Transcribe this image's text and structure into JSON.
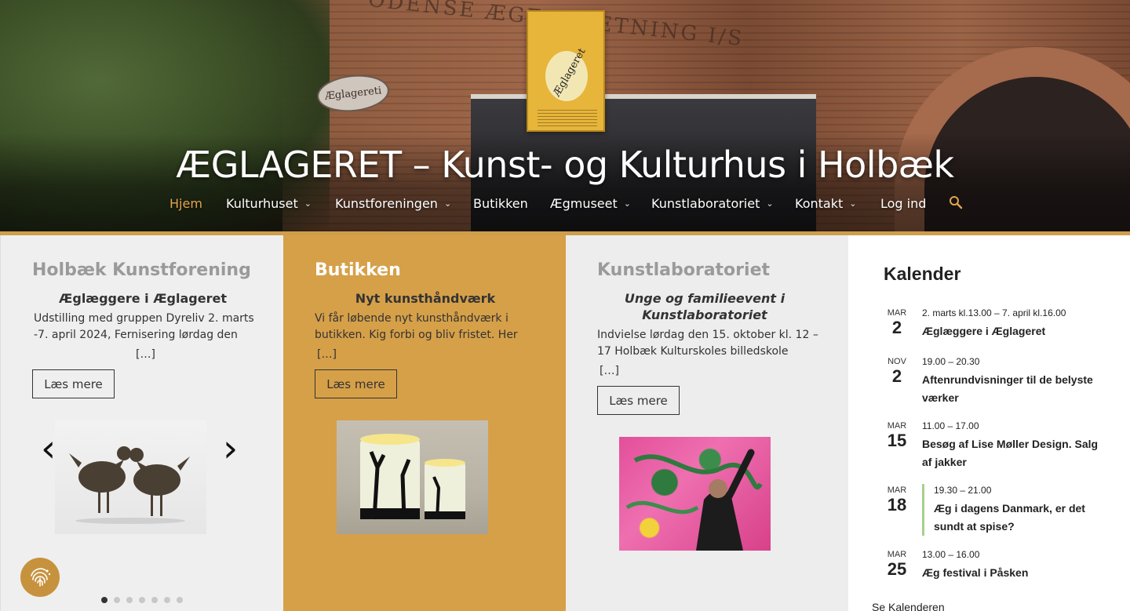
{
  "hero": {
    "site_title": "ÆGLAGERET – Kunst- og Kulturhus i Holbæk",
    "sign_text": "Æglagereti",
    "wall_text": "ODENSE ÆGFORRETNING I/S",
    "logo_text": "Æglageret"
  },
  "nav": {
    "items": [
      {
        "label": "Hjem",
        "active": true,
        "dropdown": false
      },
      {
        "label": "Kulturhuset",
        "dropdown": true
      },
      {
        "label": "Kunstforeningen",
        "dropdown": true
      },
      {
        "label": "Butikken",
        "dropdown": false
      },
      {
        "label": "Ægmuseet",
        "dropdown": true
      },
      {
        "label": "Kunstlaboratoriet",
        "dropdown": true
      },
      {
        "label": "Kontakt",
        "dropdown": true
      },
      {
        "label": "Log ind",
        "dropdown": false
      }
    ],
    "search_icon": "search-icon",
    "active_color": "#e1a54e"
  },
  "panels": [
    {
      "title": "Holbæk Kunstforening",
      "item_title": "Æglæggere i Æglageret",
      "text": "Udstilling med gruppen Dyreliv 2. marts -7. april 2024,      Fernisering lørdag den",
      "ellipsis": "[…]",
      "button": "Læs mere"
    },
    {
      "title": "Butikken",
      "item_title": "Nyt kunsthåndværk",
      "text": "Vi får løbende nyt kunsthåndværk i butikken. Kig forbi og bliv fristet. Her",
      "ellipsis": "[…]",
      "button": "Læs mere"
    },
    {
      "title": "Kunstlaboratoriet",
      "item_title": "Unge og familieevent i Kunstlaboratoriet",
      "text": "Indvielse lørdag den 15. oktober kl. 12 – 17  Holbæk Kulturskoles billedskole",
      "ellipsis": "[…]",
      "button": "Læs mere"
    }
  ],
  "slider": {
    "prev": "‹",
    "next": "›",
    "dot_count": 7,
    "active_dot": 1
  },
  "calendar": {
    "title": "Kalender",
    "events": [
      {
        "month": "MAR",
        "day": "2",
        "time": "2. marts kl.13.00 – 7. april kl.16.00",
        "name": "Æglæggere i Æglageret"
      },
      {
        "month": "NOV",
        "day": "2",
        "time": "19.00 – 20.30",
        "name": "Aftenrundvisninger til de belyste værker"
      },
      {
        "month": "MAR",
        "day": "15",
        "time": "11.00 – 17.00",
        "name": "Besøg af Lise Møller Design. Salg af jakker"
      },
      {
        "month": "MAR",
        "day": "18",
        "time": "19.30 – 21.00",
        "name": "Æg i dagens Danmark, er det sundt at spise?"
      },
      {
        "month": "MAR",
        "day": "25",
        "time": "13.00 – 16.00",
        "name": "Æg festival i Påsken"
      }
    ],
    "see_all": "Se Kalenderen"
  },
  "colors": {
    "gold": "#cf9e4b",
    "orange_panel": "#d6a049",
    "cookie_badge": "#c7923d"
  }
}
